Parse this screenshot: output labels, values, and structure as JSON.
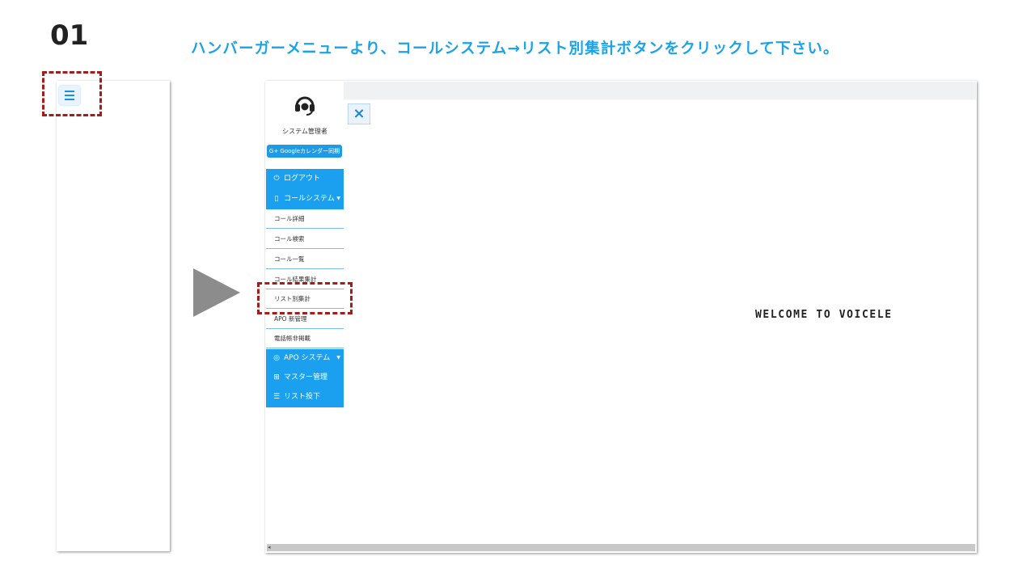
{
  "step": {
    "number": "01"
  },
  "instruction": "ハンバーガーメニューより、コールシステム→リスト別集計ボタンをクリックして下さい。",
  "colors": {
    "instruction": "#1aa3e8",
    "sidebar_blue": "#1aa0ef",
    "highlight": "#a31d1d"
  },
  "sidebar": {
    "user_name": "システム管理者",
    "gcal_button": "G+ Googleカレンダー同期",
    "logout": "ログアウト",
    "call_system": "コールシステム",
    "call_items": [
      "コール詳細",
      "コール検索",
      "コール一覧",
      "コール結果集計",
      "リスト別集計",
      "APO 新管理",
      "電話帳非掲載"
    ],
    "apo_system": "APO システム",
    "master": "マスター管理",
    "list_input": "リスト投下",
    "icons": [
      "headset-icon",
      "power-icon",
      "phone-icon",
      "globe-icon",
      "sliders-icon",
      "list-icon"
    ]
  },
  "close_icon": "×",
  "welcome": "WELCOME TO VOICELE"
}
